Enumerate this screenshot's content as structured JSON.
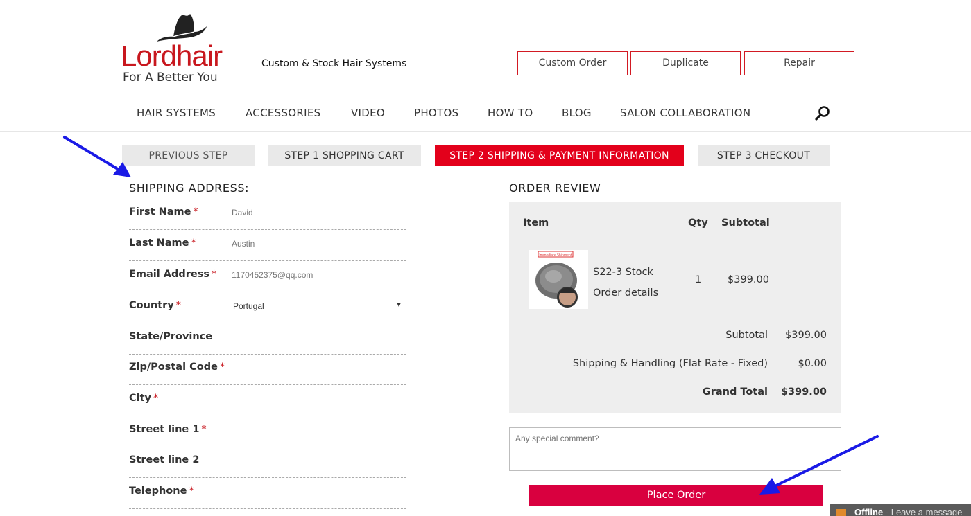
{
  "brand": {
    "logo_text": "Lordhair",
    "logo_tagline": "For A Better You",
    "tagline": "Custom & Stock Hair Systems",
    "accent_color": "#c8171e"
  },
  "header_buttons": [
    "Custom Order",
    "Duplicate",
    "Repair"
  ],
  "nav": [
    "HAIR SYSTEMS",
    "ACCESSORIES",
    "VIDEO",
    "PHOTOS",
    "HOW TO",
    "BLOG",
    "SALON COLLABORATION"
  ],
  "search_icon": "search-icon",
  "steps": {
    "previous": "PREVIEOUS STEP",
    "step1": "STEP 1 SHOPPING CART",
    "step2": "STEP 2 SHIPPING & PAYMENT INFORMATION",
    "step3": "STEP 3 CHECKOUT"
  },
  "shipping": {
    "title": "SHIPPING ADDRESS:",
    "fields": [
      {
        "label": "First Name",
        "required": "*",
        "value": "David"
      },
      {
        "label": "Last Name",
        "required": "*",
        "value": "Austin"
      },
      {
        "label": "Email Address",
        "required": "*",
        "value": "1170452375@qq.com"
      },
      {
        "label": "Country",
        "required": "*",
        "value": "Portugal"
      },
      {
        "label": "State/Province",
        "required": "",
        "value": ""
      },
      {
        "label": "Zip/Postal Code",
        "required": "*",
        "value": ""
      },
      {
        "label": "City",
        "required": "*",
        "value": ""
      },
      {
        "label": "Street line 1",
        "required": "*",
        "value": ""
      },
      {
        "label": "Street line 2",
        "required": "",
        "value": ""
      },
      {
        "label": "Telephone",
        "required": "*",
        "value": ""
      }
    ]
  },
  "review": {
    "title": "ORDER REVIEW",
    "headers": {
      "item": "Item",
      "qty": "Qty",
      "subtotal": "Subtotal"
    },
    "item": {
      "name": "S22-3 Stock",
      "details_link": "Order details",
      "qty": "1",
      "price": "$399.00",
      "thumb_badge": "Immediate Shipment"
    },
    "totals": {
      "subtotal_label": "Subtotal",
      "subtotal_value": "$399.00",
      "shipping_label": "Shipping & Handling (Flat Rate - Fixed)",
      "shipping_value": "$0.00",
      "grand_label": "Grand Total",
      "grand_value": "$399.00"
    },
    "comment_placeholder": "Any special comment?",
    "place_order": "Place Order"
  },
  "chat": {
    "status": "Offline",
    "message": " - Leave a message"
  },
  "annotation_color": "#1a1ae6"
}
